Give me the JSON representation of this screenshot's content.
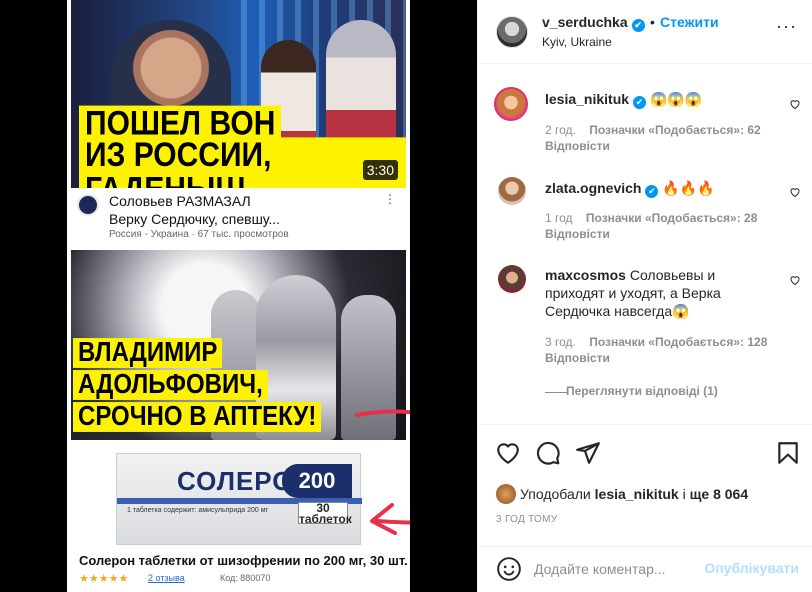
{
  "post": {
    "media": {
      "video1": {
        "headline_line1": "ПОШЕЛ ВОН",
        "headline_line2": "ИЗ РОССИИ, ГАДЕНЫШ",
        "duration": "3:30",
        "title_line1": "Соловьев РАЗМАЗАЛ",
        "title_line2": "Верку Сердючку, спевшу...",
        "meta": "Россия - Украина · 67 тыс. просмотров",
        "more": "⋮"
      },
      "video2": {
        "headline_line1": "ВЛАДИМИР",
        "headline_line2": "АДОЛЬФОВИЧ,",
        "headline_line3": "СРОЧНО В АПТЕКУ!"
      },
      "product": {
        "brand": "СОЛЕРОН",
        "dose": "200",
        "count": "30 таблеток",
        "small_text": "1 таблетка содержит: амисульприда 200 мг",
        "title": "Солерон таблетки от шизофрении по 200 мг, 30 шт.",
        "stars": "★★★★★",
        "reviews": "2 отзыва",
        "code": "Код: 880070"
      },
      "arrow_color": "#e8304a"
    },
    "header": {
      "username": "v_serduchka",
      "verified_icon": "✔",
      "separator": "•",
      "follow_label": "Стежити",
      "location": "Kyiv, Ukraine",
      "more_icon": "···"
    },
    "comments": [
      {
        "username": "lesia_nikituk",
        "verified": true,
        "text": "😱😱😱",
        "time": "2 год.",
        "likes": "Позначки «Подобається»: 62",
        "reply": "Відповісти"
      },
      {
        "username": "zlata.ognevich",
        "verified": true,
        "text": "🔥🔥🔥",
        "time": "1 год",
        "likes": "Позначки «Подобається»: 28",
        "reply": "Відповісти"
      },
      {
        "username": "maxcosmos",
        "verified": false,
        "text": "Соловьевы и приходят и уходят, а Верка Сердючка навсегда😱",
        "time": "3 год.",
        "likes": "Позначки «Подобається»: 128",
        "reply": "Відповісти",
        "view_replies": "Переглянути відповіді (1)"
      }
    ],
    "likes_summary": {
      "prefix": "Уподобали ",
      "user": "lesia_nikituk",
      "middle": " і ",
      "count": "ще 8 064"
    },
    "timestamp": "3 ГОД ТОМУ",
    "add_comment": {
      "placeholder": "Додайте коментар...",
      "publish_label": "Опублікувати"
    },
    "colors": {
      "accent": "#0095f6",
      "headline_bg": "#fef200",
      "muted": "#8e8e8e"
    }
  }
}
